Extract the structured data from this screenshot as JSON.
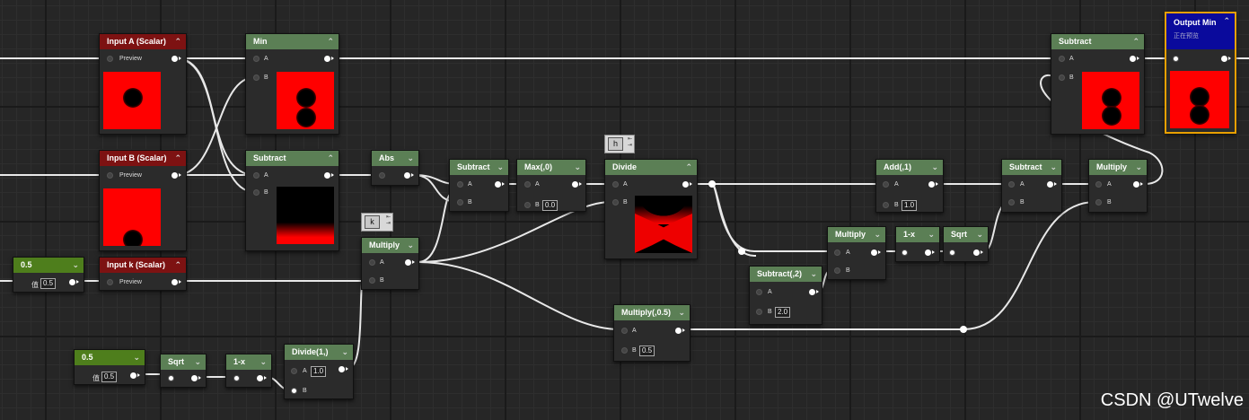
{
  "nodes": {
    "inputA": {
      "title": "Input A (Scalar)",
      "preview": "Preview"
    },
    "inputB": {
      "title": "Input B (Scalar)",
      "preview": "Preview"
    },
    "inputK": {
      "title": "Input k (Scalar)",
      "preview": "Preview"
    },
    "const1": {
      "title": "0.5",
      "param": "值",
      "value": "0.5"
    },
    "const2": {
      "title": "0.5",
      "param": "值",
      "value": "0.5"
    },
    "min": {
      "title": "Min",
      "pinA": "A",
      "pinB": "B"
    },
    "subtract1": {
      "title": "Subtract",
      "pinA": "A",
      "pinB": "B"
    },
    "abs": {
      "title": "Abs"
    },
    "multiply1": {
      "title": "Multiply",
      "pinA": "A",
      "pinB": "B"
    },
    "subtract2": {
      "title": "Subtract",
      "pinA": "A",
      "pinB": "B"
    },
    "max": {
      "title": "Max(,0)",
      "pinA": "A",
      "pinB": "B",
      "valueB": "0.0"
    },
    "divide": {
      "title": "Divide",
      "pinA": "A",
      "pinB": "B"
    },
    "sqrt1": {
      "title": "Sqrt"
    },
    "oneMinus1": {
      "title": "1-x"
    },
    "divide2": {
      "title": "Divide(1,)",
      "pinA": "A",
      "pinB": "B",
      "valueA": "1.0"
    },
    "multiplyHalf": {
      "title": "Multiply(,0.5)",
      "pinA": "A",
      "pinB": "B",
      "valueB": "0.5"
    },
    "subtract3": {
      "title": "Subtract(,2)",
      "pinA": "A",
      "pinB": "B",
      "valueB": "2.0"
    },
    "multiply2": {
      "title": "Multiply",
      "pinA": "A",
      "pinB": "B"
    },
    "oneMinus2": {
      "title": "1-x"
    },
    "sqrt2": {
      "title": "Sqrt"
    },
    "add": {
      "title": "Add(,1)",
      "pinA": "A",
      "pinB": "B",
      "valueB": "1.0"
    },
    "subtract4": {
      "title": "Subtract",
      "pinA": "A",
      "pinB": "B"
    },
    "multiply3": {
      "title": "Multiply",
      "pinA": "A",
      "pinB": "B"
    },
    "subtract5": {
      "title": "Subtract",
      "pinA": "A",
      "pinB": "B"
    },
    "outputMin": {
      "title": "Output Min",
      "subtitle": "正在预览"
    }
  },
  "comments": {
    "h": "h",
    "k": "k"
  },
  "watermark": "CSDN @UTwelve",
  "colors": {
    "header_green": "#5b7f55",
    "header_red": "#7d1212",
    "header_lime": "#4e7e1c",
    "output_blue": "#0a0a9c",
    "output_border": "#e8a000",
    "preview_red": "#ff0000"
  }
}
